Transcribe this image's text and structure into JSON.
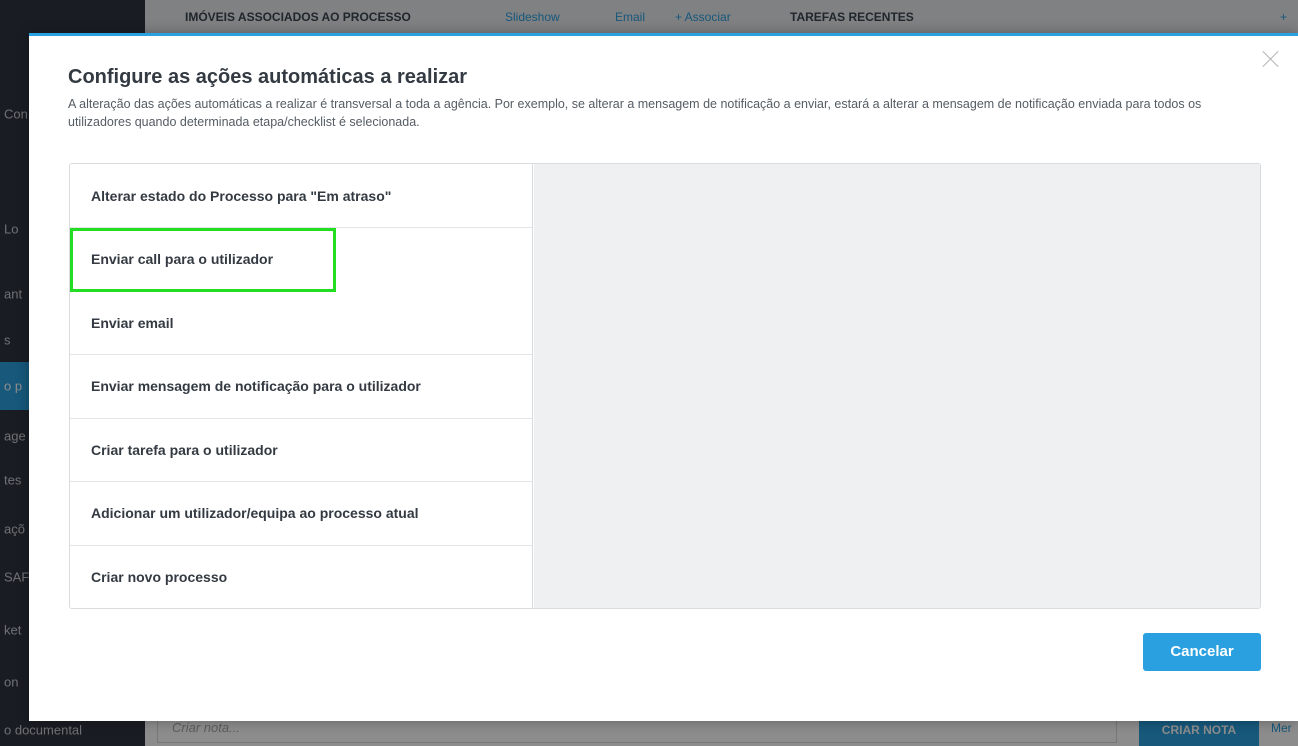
{
  "background": {
    "sidebar": {
      "items": [
        {
          "label": "Con"
        },
        {
          "label": "Lo"
        },
        {
          "label": "ant"
        },
        {
          "label": "s"
        },
        {
          "label": "o p"
        },
        {
          "label": "age"
        },
        {
          "label": "tes"
        },
        {
          "label": "açõ"
        },
        {
          "label": "SAF"
        },
        {
          "label": "ket"
        },
        {
          "label": "on"
        },
        {
          "label": "o documental"
        }
      ]
    },
    "topbar": {
      "section_title": "IMÓVEIS ASSOCIADOS AO PROCESSO",
      "slideshow": "Slideshow",
      "email": "Email",
      "associar": "+ Associar",
      "tasks_title": "TAREFAS RECENTES",
      "add": "+"
    },
    "bottom": {
      "note_placeholder": "Criar nota...",
      "note_button": "CRIAR NOTA",
      "more": "Mer"
    }
  },
  "modal": {
    "title": "Configure as ações automáticas a realizar",
    "description": "A alteração das ações automáticas a realizar é transversal a toda a agência. Por exemplo, se alterar a mensagem de notificação a enviar, estará a alterar a mensagem de notificação enviada para todos os utilizadores quando determinada etapa/checklist é selecionada.",
    "actions": [
      "Alterar estado do Processo para \"Em atraso\"",
      "Enviar call para o utilizador",
      "Enviar email",
      "Enviar mensagem de notificação para o utilizador",
      "Criar tarefa para o utilizador",
      "Adicionar um utilizador/equipa ao processo atual",
      "Criar novo processo"
    ],
    "highlighted_action_index": 1,
    "cancel_label": "Cancelar"
  },
  "colors": {
    "accent": "#2aa0e0",
    "highlight": "#22dd22",
    "sidebar": "#2f3540"
  }
}
